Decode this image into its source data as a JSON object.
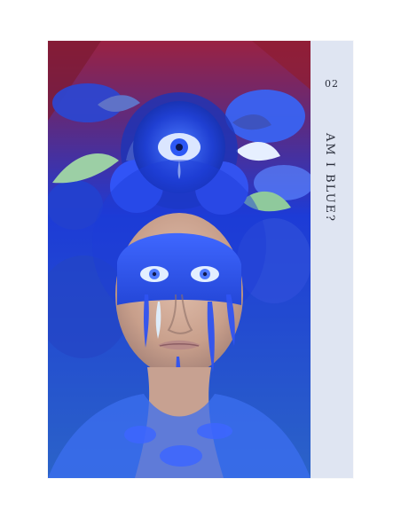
{
  "card": {
    "number": "02",
    "title": "AM I BLUE?"
  },
  "artwork": {
    "subject": "portrait-illustration",
    "colors": {
      "deep_blue": "#1d3bd6",
      "royal_blue": "#2f5cff",
      "light_blue": "#8db6ff",
      "skin": "#d9b8a8",
      "red_background": "#a1223c",
      "panel": "#dfe5f2"
    }
  }
}
